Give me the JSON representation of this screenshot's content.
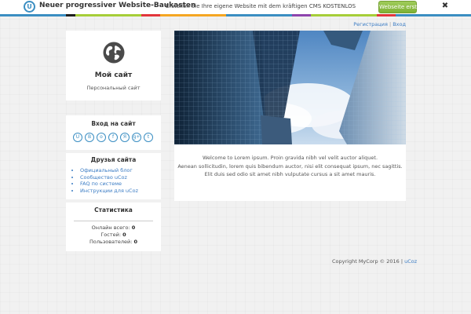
{
  "topbar": {
    "logo_glyph": "U",
    "brand": "Neuer progressiver Website-Baukasten",
    "promo": "Erstellen Sie Ihre eigene Website mit dem kräftigen CMS KOSTENLOS",
    "cta_label": "Webseite erstellen",
    "close_glyph": "✖"
  },
  "auth": {
    "register": "Регистрация",
    "separator": "|",
    "login": "Вход"
  },
  "site": {
    "title": "Мой сайт",
    "subtitle": "Персональный сайт",
    "icon": "globe-icon"
  },
  "login_block": {
    "title": "Вход на сайт",
    "providers": [
      {
        "name": "ucoz-icon",
        "glyph": "U"
      },
      {
        "name": "vk-icon",
        "glyph": "В"
      },
      {
        "name": "odnoklassniki-icon",
        "glyph": "о"
      },
      {
        "name": "facebook-icon",
        "glyph": "f"
      },
      {
        "name": "yandex-icon",
        "glyph": "Я"
      },
      {
        "name": "google-plus-icon",
        "glyph": "g+"
      },
      {
        "name": "twitter-icon",
        "glyph": "t"
      }
    ]
  },
  "friends": {
    "title": "Друзья сайта",
    "links": [
      "Официальный блог",
      "Сообщество uCoz",
      "FAQ по системе",
      "Инструкции для uCoz"
    ]
  },
  "stats": {
    "title": "Статистика",
    "online_label": "Онлайн всего:",
    "online_value": "0",
    "guests_label": "Гостей:",
    "guests_value": "0",
    "users_label": "Пользователей:",
    "users_value": "0"
  },
  "main": {
    "lines": [
      "Welcome to Lorem ipsum. Proin gravida nibh vel velit auctor aliquet.",
      "Aenean sollicitudin, lorem quis bibendum auctor, nisi elit consequat ipsum, nec sagittis.",
      "Elit duis sed odio sit amet nibh vulputate cursus a sit amet mauris."
    ]
  },
  "footer": {
    "copyright": "Copyright MyCorp © 2016",
    "separator": "|",
    "link": "uCoz"
  },
  "colors": {
    "accent": "#3b8ec2",
    "link": "#3b7cc4",
    "cta": "#8cbf46"
  }
}
